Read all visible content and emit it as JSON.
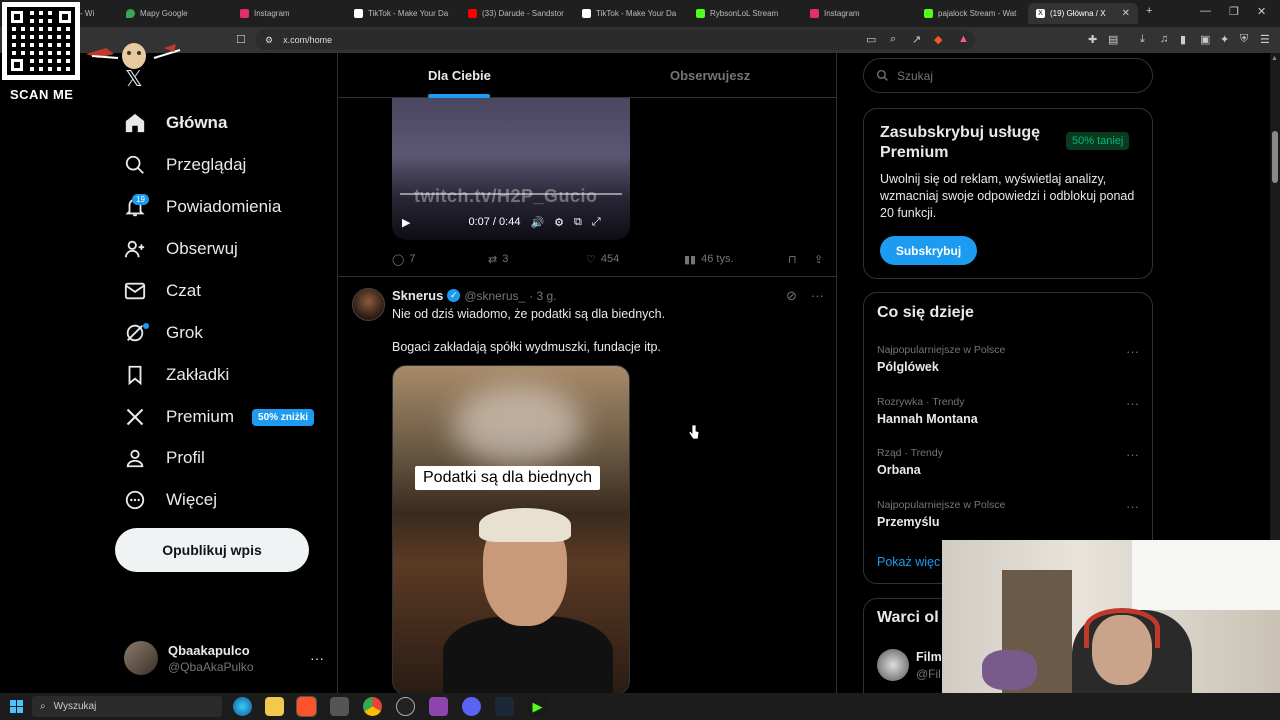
{
  "browser": {
    "tabs": [
      {
        "title": "- Wi",
        "icon_color": "#888888"
      },
      {
        "title": "Mapy Google",
        "icon_color": "#34a853"
      },
      {
        "title": "Instagram",
        "icon_color": "#e1306c"
      },
      {
        "title": "TikTok - Make Your Da",
        "icon_color": "#ffffff"
      },
      {
        "title": "(33) Darude - Sandstor",
        "icon_color": "#ff0000"
      },
      {
        "title": "TikTok - Make Your Da",
        "icon_color": "#ffffff"
      },
      {
        "title": "RybsonLoL Stream",
        "icon_color": "#53fc18"
      },
      {
        "title": "Instagram",
        "icon_color": "#e1306c"
      },
      {
        "title": "pajalock Stream - Wat",
        "icon_color": "#53fc18"
      },
      {
        "title": "(19) Główna / X",
        "icon_color": "#ffffff"
      }
    ],
    "url": "x.com/home"
  },
  "overlay": {
    "scan_label": "SCAN ME"
  },
  "nav": {
    "items": [
      {
        "label": "Główna",
        "icon": "home-icon"
      },
      {
        "label": "Przeglądaj",
        "icon": "search-icon"
      },
      {
        "label": "Powiadomienia",
        "icon": "bell-icon",
        "badge": "19"
      },
      {
        "label": "Obserwuj",
        "icon": "follow-icon"
      },
      {
        "label": "Czat",
        "icon": "mail-icon"
      },
      {
        "label": "Grok",
        "icon": "grok-icon"
      },
      {
        "label": "Zakładki",
        "icon": "bookmark-icon"
      },
      {
        "label": "Premium",
        "icon": "x-icon",
        "pill": "50% zniżki"
      },
      {
        "label": "Profil",
        "icon": "profile-icon"
      },
      {
        "label": "Więcej",
        "icon": "more-icon"
      }
    ],
    "post_button": "Opublikuj wpis",
    "user": {
      "name": "Qbaakapulco",
      "handle": "@QbaAkaPulko"
    }
  },
  "feed": {
    "tabs": [
      "Dla Ciebie",
      "Obserwujesz"
    ],
    "video1": {
      "watermark": "twitch.tv/H2P_Gucio",
      "time": "0:07 / 0:44"
    },
    "tweet1_stats": {
      "replies": "7",
      "reposts": "3",
      "likes": "454",
      "views": "46 tys."
    },
    "tweet2": {
      "name": "Sknerus",
      "handle": "@sknerus_",
      "time": "· 3 g.",
      "line1": "Nie od dziś wiadomo, że podatki są dla biednych.",
      "line2": "Bogaci zakładają spółki wydmuszki, fundacje itp.",
      "caption": "Podatki są dla biednych"
    }
  },
  "sidebar": {
    "search_placeholder": "Szukaj",
    "premium": {
      "title": "Zasubskrybuj usługę Premium",
      "badge": "50% taniej",
      "desc": "Uwolnij się od reklam, wyświetlaj analizy, wzmacniaj swoje odpowiedzi i odblokuj ponad 20 funkcji.",
      "button": "Subskrybuj"
    },
    "trends": {
      "title": "Co się dzieje",
      "items": [
        {
          "category": "Najpopularniejsze w Polsce",
          "name": "Pólglówek"
        },
        {
          "category": "Rozrywka · Trendy",
          "name": "Hannah Montana"
        },
        {
          "category": "Rząd · Trendy",
          "name": "Orbana"
        },
        {
          "category": "Najpopularniejsze w Polsce",
          "name": "Przemyślu"
        }
      ],
      "show_more": "Pokaż więc"
    },
    "who_to_follow": {
      "title": "Warci ol",
      "name": "Film",
      "handle": "@Fil"
    }
  },
  "taskbar": {
    "search": "Wyszukaj"
  }
}
